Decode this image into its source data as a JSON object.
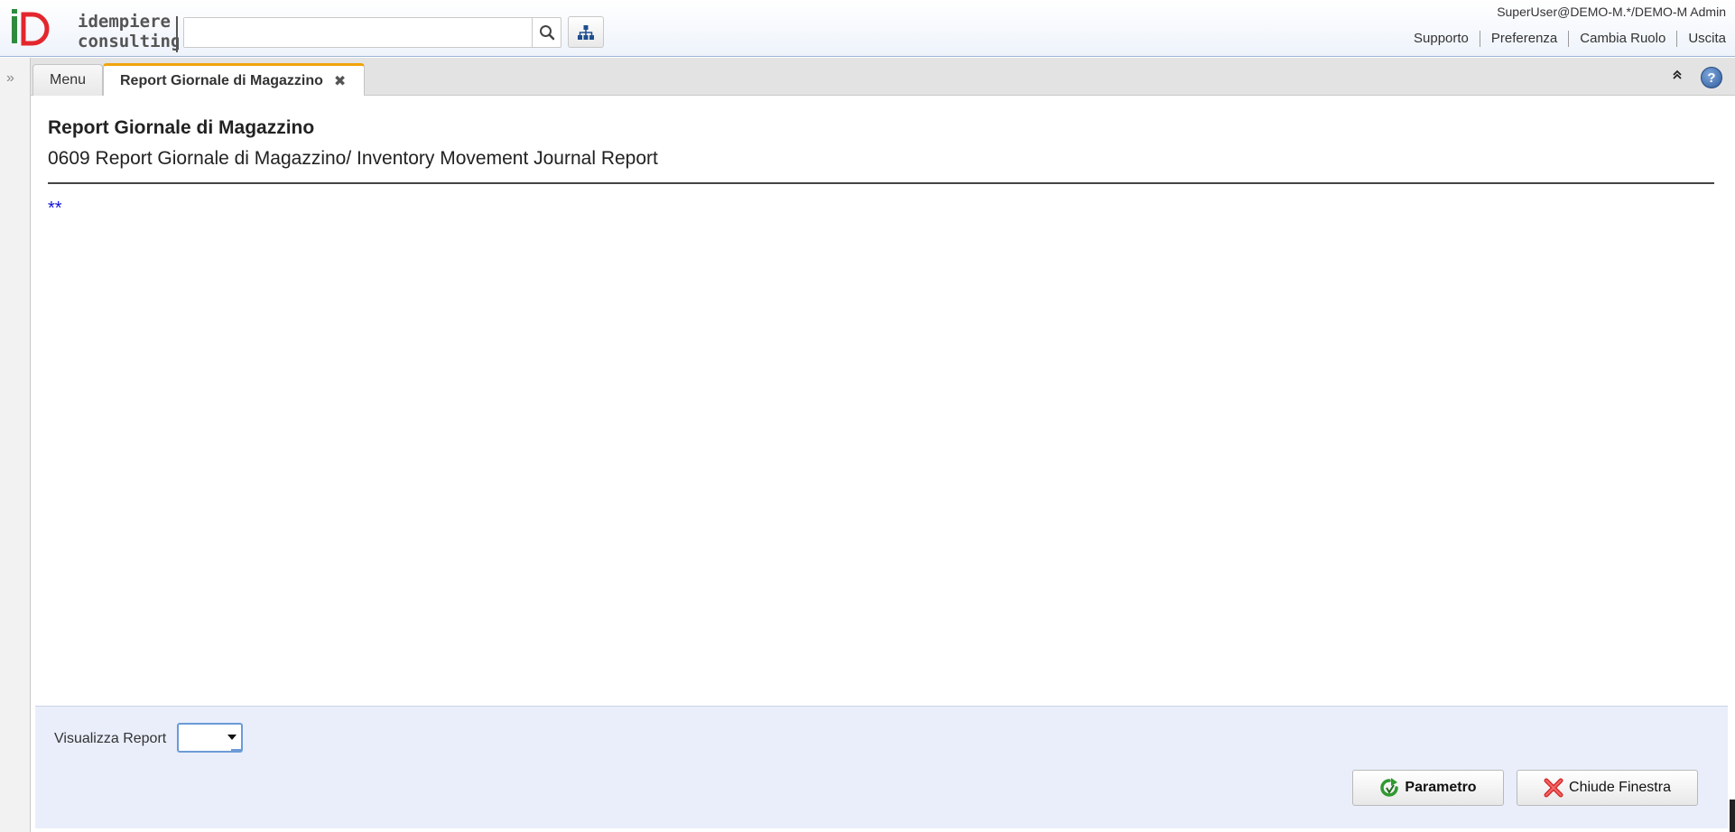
{
  "header": {
    "logo_text_line1": "idempiere",
    "logo_text_line2": "consulting",
    "search": {
      "value": "",
      "placeholder": ""
    },
    "user_info": "SuperUser@DEMO-M.*/DEMO-M Admin",
    "links": [
      "Supporto",
      "Preferenza",
      "Cambia Ruolo",
      "Uscita"
    ]
  },
  "tabs": [
    {
      "label": "Menu",
      "active": false
    },
    {
      "label": "Report Giornale di Magazzino",
      "active": true,
      "closable": true
    }
  ],
  "content": {
    "title": "Report Giornale di Magazzino",
    "subtitle": "0609 Report Giornale di Magazzino/ Inventory Movement Journal Report",
    "marker": "**"
  },
  "bottom": {
    "visualizza_label": "Visualizza Report",
    "visualizza_value": "",
    "param_button": "Parametro",
    "close_button": "Chiude Finestra"
  },
  "colors": {
    "accent_tab": "#f0a30a",
    "panel_bg": "#e9eefa",
    "marker": "#1212e0",
    "logo_green": "#2e8b3e",
    "logo_red": "#e3262d"
  },
  "icons": {
    "search": "search-icon",
    "tree": "sitemap-icon",
    "toggle_west": "double-chevron-right-icon",
    "collapse": "double-chevron-up-icon",
    "help": "help-icon",
    "param": "green-refresh-arrow-icon",
    "close": "red-x-icon"
  }
}
